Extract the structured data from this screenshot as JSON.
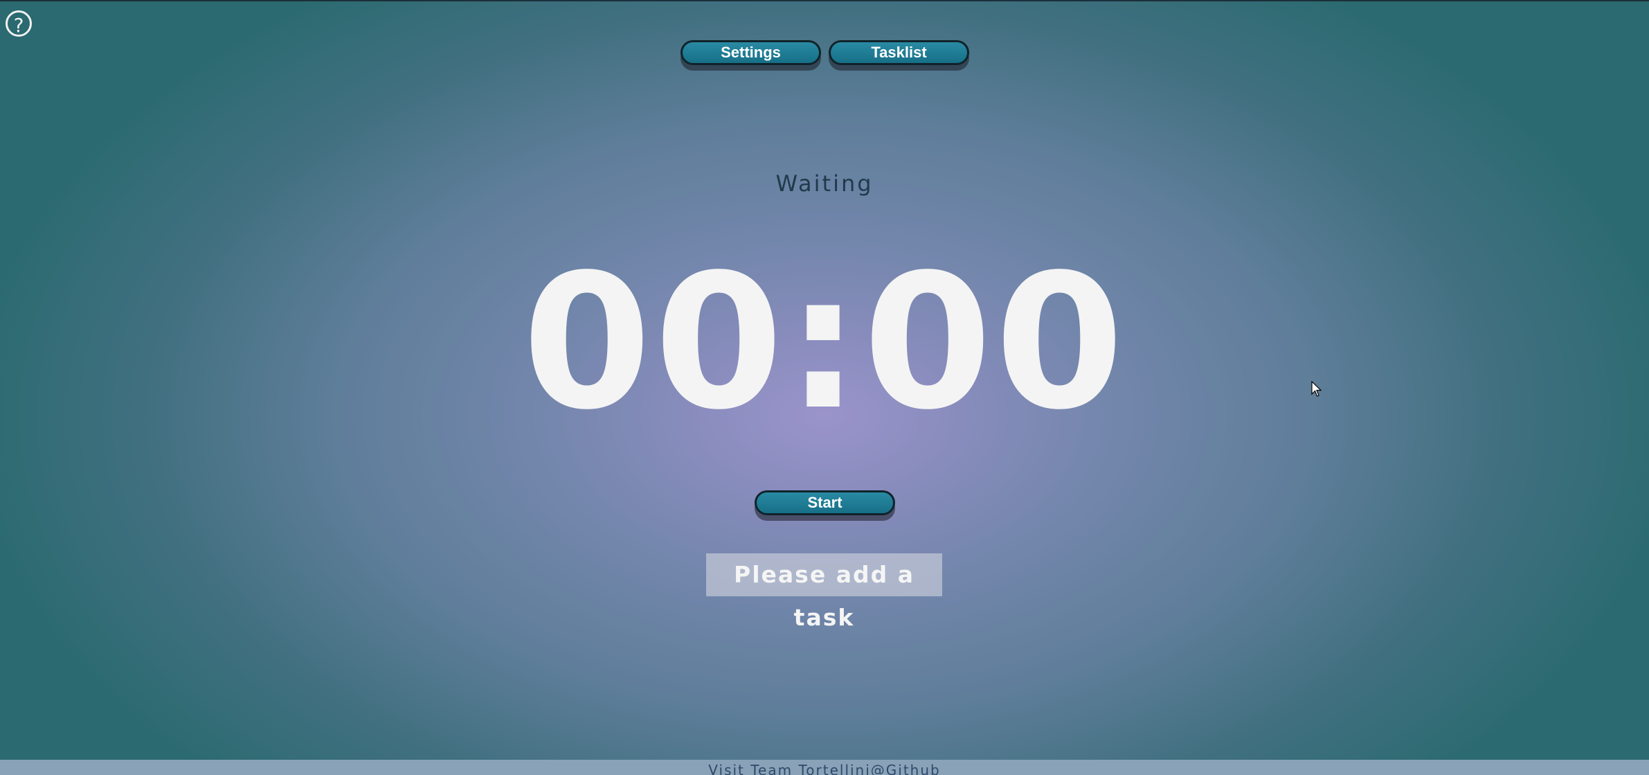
{
  "help": {
    "icon": "question-circle-icon",
    "label": "?"
  },
  "nav": {
    "settings_label": "Settings",
    "tasklist_label": "Tasklist"
  },
  "timer": {
    "status": "Waiting",
    "display": "00:00",
    "start_label": "Start"
  },
  "task": {
    "message": "Please add a task"
  },
  "footer": {
    "link_text": "Visit Team Tortellini@Github"
  },
  "colors": {
    "button": "#1f7f98",
    "button_border": "#10232a",
    "timer_text": "#f4f4f4",
    "status_text": "#1f3a4a",
    "background_center": "#9a94cb",
    "background_edge": "#2a6a70"
  }
}
